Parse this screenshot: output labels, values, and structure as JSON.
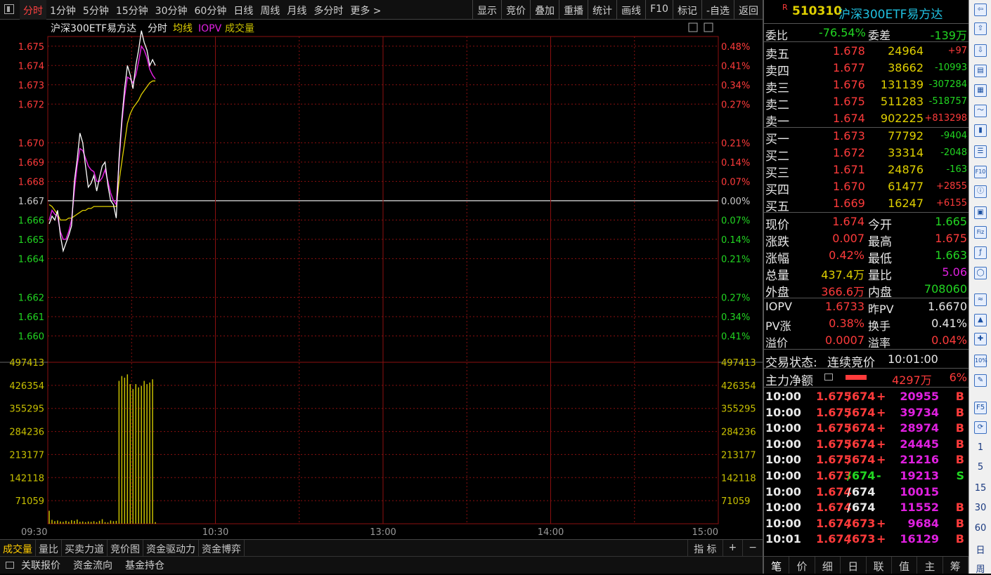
{
  "topbar": {
    "periods": [
      "分时",
      "1分钟",
      "5分钟",
      "15分钟",
      "30分钟",
      "60分钟",
      "日线",
      "周线",
      "月线",
      "多分时",
      "更多 >"
    ],
    "active_period": "分时",
    "tools": [
      "显示",
      "竞价",
      "叠加",
      "重播",
      "统计",
      "画线",
      "F10",
      "标记",
      "-自选",
      "返回"
    ]
  },
  "chart_header": {
    "name": "沪深300ETF易方达",
    "mode": "分时",
    "avg": "均线",
    "iopv": "IOPV",
    "vol": "成交量"
  },
  "colors": {
    "up": "#ff3b3b",
    "down": "#22d622",
    "price": "#ffffff",
    "avg": "#e0d000",
    "iopv": "#e020e0",
    "volume": "#c8c000",
    "grid": "#8b1010"
  },
  "chart_data": {
    "type": "line",
    "y_price_labels": [
      "1.675",
      "1.674",
      "1.673",
      "1.672",
      "1.670",
      "1.669",
      "1.668",
      "1.667",
      "1.666",
      "1.665",
      "1.664",
      "1.662",
      "1.661",
      "1.660"
    ],
    "y_pct_labels": [
      "0.48%",
      "0.41%",
      "0.34%",
      "0.27%",
      "0.21%",
      "0.14%",
      "0.07%",
      "0.00%",
      "0.07%",
      "0.14%",
      "0.21%",
      "0.27%",
      "0.34%",
      "0.41%"
    ],
    "pre_close": 1.667,
    "ylim": [
      1.6598,
      1.6755
    ],
    "vol_labels": [
      "497413",
      "426354",
      "355295",
      "284236",
      "213177",
      "142118",
      "71059"
    ],
    "vol_max": 497413,
    "x_labels": [
      "09:30",
      "10:30",
      "13:00",
      "14:00",
      "15:00"
    ],
    "total_minutes": 240,
    "price": [
      1.6658,
      1.6662,
      1.666,
      1.6665,
      1.6652,
      1.6644,
      1.6648,
      1.6652,
      1.6657,
      1.668,
      1.6691,
      1.6705,
      1.67,
      1.6688,
      1.6677,
      1.6679,
      1.6683,
      1.6675,
      1.6682,
      1.6688,
      1.669,
      1.6678,
      1.667,
      1.6668,
      1.6661,
      1.6692,
      1.6712,
      1.6728,
      1.674,
      1.6735,
      1.6728,
      1.674,
      1.6748,
      1.6758,
      1.6752,
      1.6748,
      1.674,
      1.6743,
      1.674
    ],
    "avg": [
      1.6668,
      1.6667,
      1.6665,
      1.6663,
      1.666,
      1.666,
      1.666,
      1.6661,
      1.6661,
      1.6662,
      1.6663,
      1.6664,
      1.6665,
      1.6665,
      1.6666,
      1.6666,
      1.6667,
      1.6667,
      1.6667,
      1.6667,
      1.6667,
      1.6667,
      1.6667,
      1.6667,
      1.6667,
      1.668,
      1.669,
      1.67,
      1.671,
      1.6715,
      1.6718,
      1.672,
      1.6722,
      1.6725,
      1.6727,
      1.6729,
      1.6731,
      1.6732,
      1.6732
    ],
    "iopv": [
      1.666,
      1.6665,
      1.6663,
      1.6662,
      1.6654,
      1.665,
      1.665,
      1.6654,
      1.666,
      1.6675,
      1.6688,
      1.6697,
      1.6696,
      1.6692,
      1.6688,
      1.6686,
      1.6685,
      1.668,
      1.668,
      1.6682,
      1.6686,
      1.668,
      1.6674,
      1.667,
      1.6668,
      1.669,
      1.671,
      1.6724,
      1.6734,
      1.6733,
      1.6731,
      1.6735,
      1.6742,
      1.675,
      1.6748,
      1.6744,
      1.6738,
      1.6735,
      1.6733
    ],
    "volume": [
      40000,
      12000,
      8000,
      10000,
      7000,
      6000,
      9000,
      6000,
      11000,
      9000,
      13000,
      6000,
      7000,
      5000,
      7000,
      6000,
      8000,
      5000,
      9000,
      14000,
      5000,
      4000,
      10000,
      8000,
      9000,
      440000,
      455000,
      450000,
      460000,
      430000,
      415000,
      430000,
      420000,
      425000,
      440000,
      430000,
      435000,
      445000,
      5000
    ]
  },
  "bottom_tabs": [
    "成交量",
    "量比",
    "买卖力道",
    "竞价图",
    "资金驱动力",
    "资金博弈"
  ],
  "bottom_right": [
    "指 标",
    "+",
    "−"
  ],
  "statusbar": [
    "关联报价",
    "资金流向",
    "基金持仓"
  ],
  "panel": {
    "badge": "R",
    "code": "510310",
    "name": "沪深300ETF易方达",
    "weibi_label": "委比",
    "weibi": "-76.54%",
    "weicha_label": "委差",
    "weicha": "-139万",
    "asks": [
      {
        "label": "卖五",
        "price": "1.678",
        "vol": "24964",
        "chg": "+97"
      },
      {
        "label": "卖四",
        "price": "1.677",
        "vol": "38662",
        "chg": "-10993"
      },
      {
        "label": "卖三",
        "price": "1.676",
        "vol": "131139",
        "chg": "-307284"
      },
      {
        "label": "卖二",
        "price": "1.675",
        "vol": "511283",
        "chg": "-518757"
      },
      {
        "label": "卖一",
        "price": "1.674",
        "vol": "902225",
        "chg": "+813298"
      }
    ],
    "bids": [
      {
        "label": "买一",
        "price": "1.673",
        "vol": "77792",
        "chg": "-9404"
      },
      {
        "label": "买二",
        "price": "1.672",
        "vol": "33314",
        "chg": "-2048"
      },
      {
        "label": "买三",
        "price": "1.671",
        "vol": "24876",
        "chg": "-163"
      },
      {
        "label": "买四",
        "price": "1.670",
        "vol": "61477",
        "chg": "+2855"
      },
      {
        "label": "买五",
        "price": "1.669",
        "vol": "16247",
        "chg": "+6155"
      }
    ],
    "quote": [
      {
        "l1": "现价",
        "v1": "1.674",
        "c1": "red",
        "l2": "今开",
        "v2": "1.665",
        "c2": "grn"
      },
      {
        "l1": "涨跌",
        "v1": "0.007",
        "c1": "red",
        "l2": "最高",
        "v2": "1.675",
        "c2": "red"
      },
      {
        "l1": "涨幅",
        "v1": "0.42%",
        "c1": "red",
        "l2": "最低",
        "v2": "1.663",
        "c2": "grn"
      },
      {
        "l1": "总量",
        "v1": "437.4万",
        "c1": "yel",
        "l2": "量比",
        "v2": "5.06",
        "c2": "mag"
      },
      {
        "l1": "外盘",
        "v1": "366.6万",
        "c1": "red",
        "l2": "内盘",
        "v2": "708060",
        "c2": "grn"
      }
    ],
    "iopv_rows": [
      {
        "l1": "IOPV",
        "v1": "1.6733",
        "c1": "red",
        "l2": "昨PV",
        "v2": "1.6670",
        "c2": "wht"
      },
      {
        "l1": "PV涨",
        "v1": "0.38%",
        "c1": "red",
        "l2": "换手",
        "v2": "0.41%",
        "c2": "wht"
      },
      {
        "l1": "溢价",
        "v1": "0.0007",
        "c1": "red",
        "l2": "溢率",
        "v2": "0.04%",
        "c2": "red"
      }
    ],
    "trade_status_label": "交易状态:",
    "trade_status": "连续竞价",
    "trade_time": "10:01:00",
    "zhuli_label": "主力净额",
    "zhuli_value": "4297万",
    "zhuli_pct": "6%",
    "ticks": [
      {
        "t": "10:00",
        "p1": "1.675",
        "p2": "674",
        "pc": "red",
        "dir": "+",
        "dc": "red",
        "vol": "20955",
        "vc": "mag",
        "bs": "B",
        "bc": "red"
      },
      {
        "t": "10:00",
        "p1": "1.675",
        "p2": "674",
        "pc": "red",
        "dir": "+",
        "dc": "red",
        "vol": "39734",
        "vc": "mag",
        "bs": "B",
        "bc": "red"
      },
      {
        "t": "10:00",
        "p1": "1.675",
        "p2": "674",
        "pc": "red",
        "dir": "+",
        "dc": "red",
        "vol": "28974",
        "vc": "mag",
        "bs": "B",
        "bc": "red"
      },
      {
        "t": "10:00",
        "p1": "1.675",
        "p2": "674",
        "pc": "red",
        "dir": "+",
        "dc": "red",
        "vol": "24445",
        "vc": "mag",
        "bs": "B",
        "bc": "red"
      },
      {
        "t": "10:00",
        "p1": "1.675",
        "p2": "674",
        "pc": "red",
        "dir": "+",
        "dc": "red",
        "vol": "21216",
        "vc": "mag",
        "bs": "B",
        "bc": "red"
      },
      {
        "t": "10:00",
        "p1": "1.673",
        "p2": "674",
        "pc": "red",
        "dir": "-",
        "dc": "grn",
        "vol": "19213",
        "vc": "mag",
        "bs": "S",
        "bc": "grn"
      },
      {
        "t": "10:00",
        "p1": "1.674",
        "p2": "674",
        "pc": "red",
        "dir": "",
        "dc": "wht",
        "vol": "10015",
        "vc": "mag",
        "bs": "",
        "bc": "wht"
      },
      {
        "t": "10:00",
        "p1": "1.674",
        "p2": "674",
        "pc": "red",
        "dir": "",
        "dc": "wht",
        "vol": "11552",
        "vc": "mag",
        "bs": "B",
        "bc": "red"
      },
      {
        "t": "10:00",
        "p1": "1.674",
        "p2": "673",
        "pc": "red",
        "dir": "+",
        "dc": "red",
        "vol": "9684",
        "vc": "mag",
        "bs": "B",
        "bc": "red"
      },
      {
        "t": "10:01",
        "p1": "1.674",
        "p2": "673",
        "pc": "red",
        "dir": "+",
        "dc": "red",
        "vol": "16129",
        "vc": "mag",
        "bs": "B",
        "bc": "red"
      }
    ],
    "tabs": [
      "笔",
      "价",
      "细",
      "日",
      "联",
      "值",
      "主",
      "筹"
    ]
  },
  "sidebar": {
    "icons": [
      "back-arrow-icon",
      "up-arrow-icon",
      "down-arrow-icon",
      "quote-icon",
      "grid-icon",
      "line-chart-icon",
      "kline-icon",
      "list-icon",
      "f10-icon",
      "info-icon",
      "news-icon",
      "fiz-icon",
      "formula-icon",
      "circle-icon",
      "wave-icon",
      "area-icon",
      "multi-icon",
      "10pct-icon",
      "pen-icon",
      "f5-icon",
      "refresh-icon"
    ],
    "icon_text": [
      "⇦",
      "⇧",
      "⇩",
      "▤",
      "▦",
      "〜",
      "▮",
      "☰",
      "F10",
      "ⓘ",
      "▣",
      "Fiz",
      "ƒ",
      "◯",
      "≈",
      "▲",
      "✚",
      "10%",
      "✎",
      "F5",
      "⟳"
    ],
    "numbers": [
      "1",
      "5",
      "15",
      "30",
      "60",
      "日",
      "周"
    ]
  }
}
